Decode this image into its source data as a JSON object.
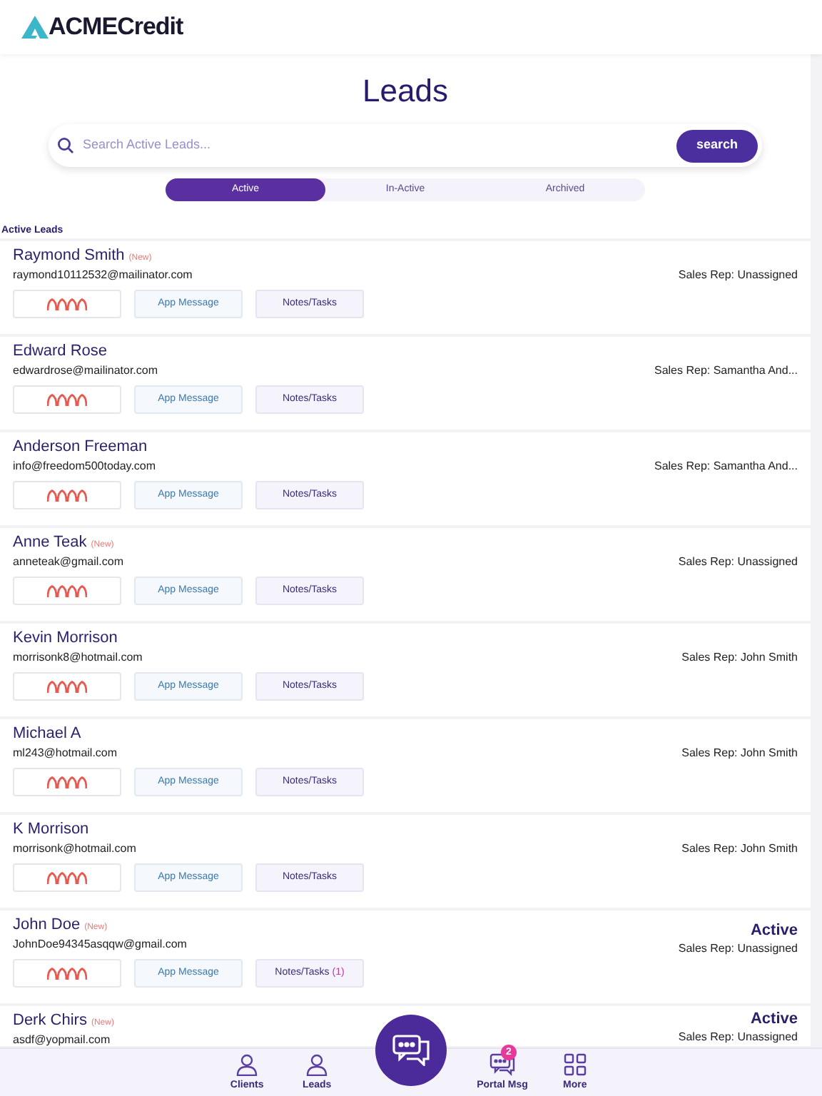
{
  "brand": {
    "name_part1": "ACME",
    "name_part2": "Credit"
  },
  "title": "Leads",
  "search": {
    "placeholder": "Search Active Leads...",
    "button": "search"
  },
  "tabs": [
    {
      "label": "Active",
      "selected": true
    },
    {
      "label": "In-Active",
      "selected": false
    },
    {
      "label": "Archived",
      "selected": false
    }
  ],
  "section_label": "Active Leads",
  "leads": [
    {
      "name": "Raymond Smith",
      "new_tag": "(New)",
      "email": "raymond10112532@mailinator.com",
      "sales_rep": "Sales Rep: Unassigned",
      "buttons": {
        "message": "App Message",
        "notes": "Notes/Tasks"
      }
    },
    {
      "name": "Edward Rose",
      "email": "edwardrose@mailinator.com",
      "sales_rep": "Sales Rep: Samantha And...",
      "buttons": {
        "message": "App Message",
        "notes": "Notes/Tasks"
      }
    },
    {
      "name": "Anderson Freeman",
      "email": "info@freedom500today.com",
      "sales_rep": "Sales Rep: Samantha And...",
      "buttons": {
        "message": "App Message",
        "notes": "Notes/Tasks"
      }
    },
    {
      "name": "Anne Teak",
      "new_tag": "(New)",
      "email": "anneteak@gmail.com",
      "sales_rep": "Sales Rep: Unassigned",
      "buttons": {
        "message": "App Message",
        "notes": "Notes/Tasks"
      }
    },
    {
      "name": "Kevin Morrison",
      "email": "morrisonk8@hotmail.com",
      "sales_rep": "Sales Rep: John Smith",
      "buttons": {
        "message": "App Message",
        "notes": "Notes/Tasks"
      }
    },
    {
      "name": "Michael A",
      "email": "ml243@hotmail.com",
      "sales_rep": "Sales Rep: John Smith",
      "buttons": {
        "message": "App Message",
        "notes": "Notes/Tasks"
      }
    },
    {
      "name": "K Morrison",
      "email": "morrisonk@hotmail.com",
      "sales_rep": "Sales Rep: John Smith",
      "buttons": {
        "message": "App Message",
        "notes": "Notes/Tasks"
      }
    },
    {
      "name": "John Doe",
      "new_tag": "(New)",
      "email": "JohnDoe94345asqqw@gmail.com",
      "status": "Active",
      "sales_rep": "Sales Rep: Unassigned",
      "buttons": {
        "message": "App Message",
        "notes": "Notes/Tasks",
        "notes_count": "(1)"
      }
    },
    {
      "name": "Derk Chirs",
      "new_tag": "(New)",
      "email": "asdf@yopmail.com",
      "status": "Active",
      "sales_rep": "Sales Rep: Unassigned"
    }
  ],
  "nav": [
    {
      "kind": "person",
      "label": "Clients"
    },
    {
      "kind": "person",
      "label": "Leads"
    },
    {
      "kind": "chat"
    },
    {
      "kind": "messages",
      "label": "Portal Msg",
      "badge": "2"
    },
    {
      "kind": "grid",
      "label": "More"
    }
  ]
}
